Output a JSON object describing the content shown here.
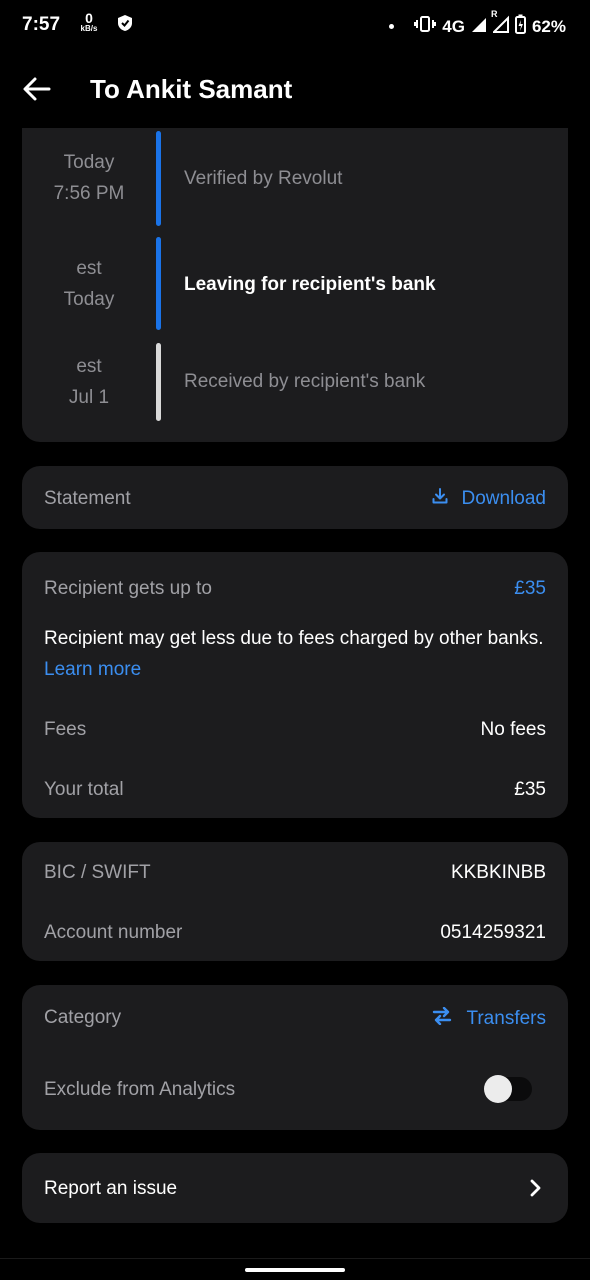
{
  "status_bar": {
    "time": "7:57",
    "speed_value": "0",
    "speed_unit": "kB/s",
    "network": "4G",
    "roaming": "R",
    "battery": "62%"
  },
  "header": {
    "title": "To Ankit Samant"
  },
  "timeline": [
    {
      "time_line1": "Today",
      "time_line2": "7:56 PM",
      "label": "Verified by Revolut",
      "state": "done",
      "color": "#1a73e8"
    },
    {
      "time_line1": "est",
      "time_line2": "Today",
      "label": "Leaving for recipient's bank",
      "state": "active",
      "color": "#1a73e8"
    },
    {
      "time_line1": "est",
      "time_line2": "Jul 1",
      "label": "Received by recipient's bank",
      "state": "pending",
      "color": "#d9d9d9"
    }
  ],
  "statement": {
    "label": "Statement",
    "action": "Download"
  },
  "amounts": {
    "recipient_label": "Recipient gets up to",
    "recipient_value": "£35",
    "note": "Recipient may get less due to fees charged by other banks.",
    "learn_more": "Learn more",
    "fees_label": "Fees",
    "fees_value": "No fees",
    "total_label": "Your total",
    "total_value": "£35"
  },
  "bank": {
    "bic_label": "BIC / SWIFT",
    "bic_value": "KKBKINBB",
    "account_label": "Account number",
    "account_value": "0514259321"
  },
  "category": {
    "label": "Category",
    "value": "Transfers",
    "exclude_label": "Exclude from Analytics",
    "exclude_on": false
  },
  "report": {
    "label": "Report an issue"
  },
  "colors": {
    "accent": "#3b8ef0",
    "card": "#1c1c1e",
    "background": "#000000"
  }
}
